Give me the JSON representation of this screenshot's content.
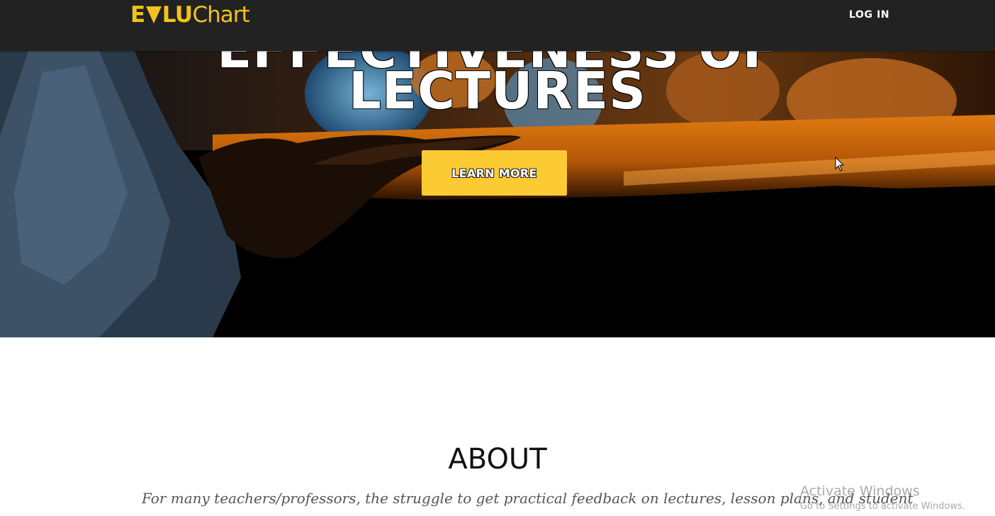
{
  "navbar": {
    "brand": {
      "bold_prefix": "E",
      "v_glyph": "V",
      "bold_suffix": "LU",
      "thin_part": "Chart"
    },
    "login_label": "LOG IN"
  },
  "hero": {
    "headline_partial": "EFFECTIVENESS OF",
    "headline": "LECTURES",
    "cta_label": "LEARN MORE"
  },
  "about": {
    "title": "ABOUT",
    "text": "For many teachers/professors, the struggle to get practical feedback on lectures, lesson plans, and student"
  },
  "watermark": {
    "title": "Activate Windows",
    "subtitle": "Go to Settings to activate Windows."
  },
  "colors": {
    "navbar_bg": "#222222",
    "brand_accent": "#f3c21b",
    "cta_bg": "#fccb34",
    "about_text": "#555555"
  },
  "icons": {
    "brand_mark": "triangle-v-icon",
    "pointer": "mouse-cursor-icon"
  }
}
